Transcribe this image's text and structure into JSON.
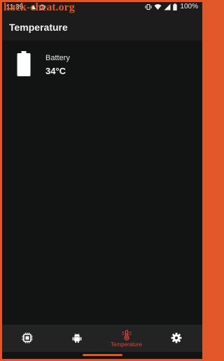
{
  "status_bar": {
    "time": "11:39",
    "battery_percent": "100%"
  },
  "watermark": {
    "text": "hack-cheat.org"
  },
  "app_bar": {
    "title": "Temperature"
  },
  "sensors": [
    {
      "name": "Battery",
      "value": "34°C",
      "icon": "battery-icon"
    }
  ],
  "bottom_nav": {
    "items": [
      {
        "id": "cpu",
        "icon": "cpu-icon",
        "label": "",
        "active": false
      },
      {
        "id": "android",
        "icon": "android-icon",
        "label": "",
        "active": false
      },
      {
        "id": "temperature",
        "icon": "thermometer-icon",
        "label": "Temperature",
        "active": true
      },
      {
        "id": "settings",
        "icon": "gear-icon",
        "label": "",
        "active": false
      }
    ]
  },
  "colors": {
    "accent": "#e0463a",
    "background": "#121313",
    "bar": "#1c1c1c",
    "nav": "#232323",
    "frame": "#e2572a"
  }
}
